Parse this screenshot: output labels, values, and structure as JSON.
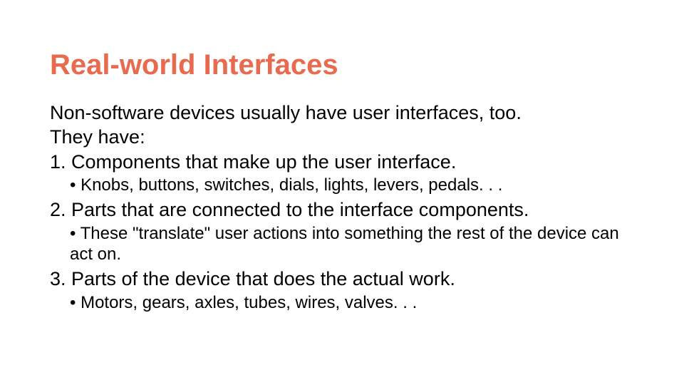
{
  "title": "Real-world Interfaces",
  "intro1": "Non-software devices usually have user interfaces, too.",
  "intro2": "They have:",
  "items": [
    {
      "num": "1. Components that make up the user interface.",
      "sub": "• Knobs, buttons, switches, dials, lights, levers, pedals. . ."
    },
    {
      "num": "2. Parts that are connected to the interface components.",
      "sub": "• These \"translate\" user actions into something the rest of the device can act on."
    },
    {
      "num": "3. Parts of the device that does the actual work.",
      "sub": "• Motors, gears, axles, tubes, wires, valves. . ."
    }
  ]
}
